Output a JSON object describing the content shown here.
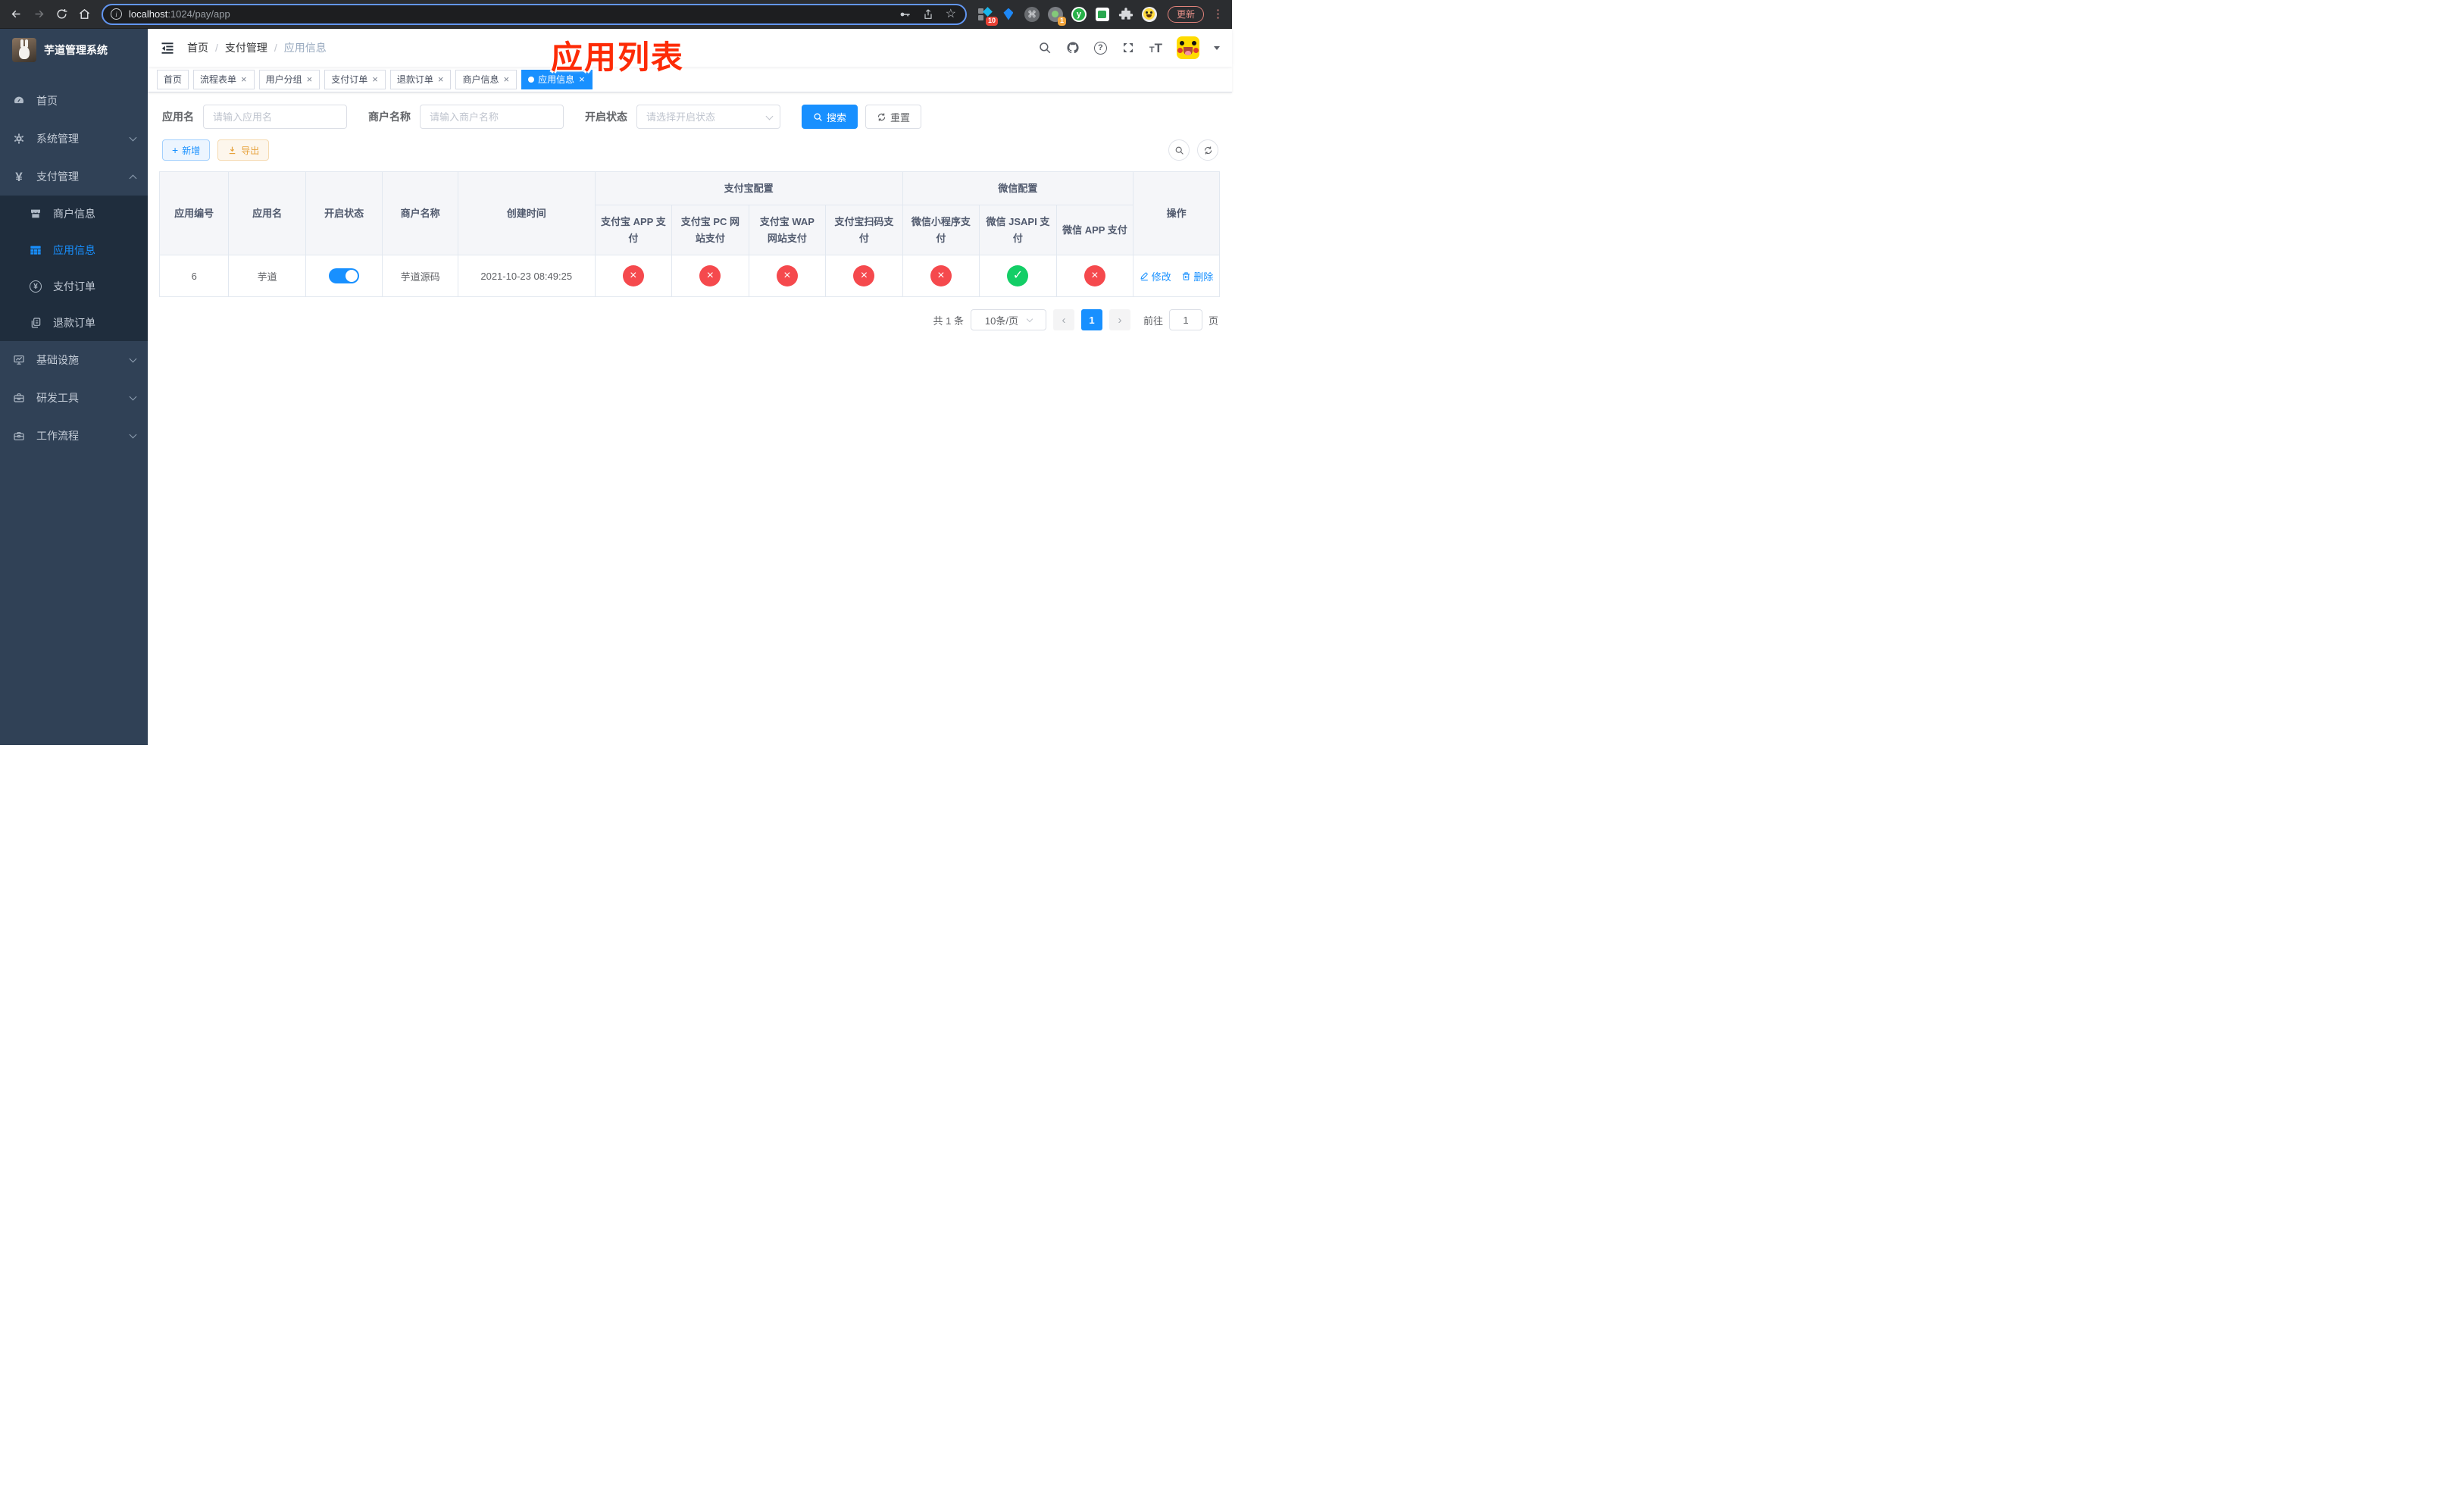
{
  "browser": {
    "url": {
      "host": "localhost",
      "path": ":1024/pay/app"
    },
    "update_button": "更新",
    "ext_badge_red": "10",
    "ext_badge_orange": "1",
    "cmd_glyph": "⌘",
    "y_glyph": "y"
  },
  "sidebar": {
    "logo_title": "芋道管理系统",
    "items": [
      {
        "label": "首页"
      },
      {
        "label": "系统管理"
      },
      {
        "label": "支付管理"
      },
      {
        "label": "商户信息"
      },
      {
        "label": "应用信息"
      },
      {
        "label": "支付订单"
      },
      {
        "label": "退款订单"
      },
      {
        "label": "基础设施"
      },
      {
        "label": "研发工具"
      },
      {
        "label": "工作流程"
      }
    ],
    "yen_glyph": "¥"
  },
  "navbar": {
    "breadcrumb": [
      "首页",
      "支付管理",
      "应用信息"
    ],
    "separator": "/"
  },
  "annotation": "应用列表",
  "tabs": [
    {
      "label": "首页",
      "closable": false,
      "active": false
    },
    {
      "label": "流程表单",
      "closable": true,
      "active": false
    },
    {
      "label": "用户分组",
      "closable": true,
      "active": false
    },
    {
      "label": "支付订单",
      "closable": true,
      "active": false
    },
    {
      "label": "退款订单",
      "closable": true,
      "active": false
    },
    {
      "label": "商户信息",
      "closable": true,
      "active": false
    },
    {
      "label": "应用信息",
      "closable": true,
      "active": true
    }
  ],
  "filters": {
    "app_name": {
      "label": "应用名",
      "placeholder": "请输入应用名",
      "value": ""
    },
    "merchant_name": {
      "label": "商户名称",
      "placeholder": "请输入商户名称",
      "value": ""
    },
    "status": {
      "label": "开启状态",
      "placeholder": "请选择开启状态",
      "value": ""
    },
    "search_label": "搜索",
    "reset_label": "重置"
  },
  "toolbar": {
    "add_label": "新增",
    "export_label": "导出"
  },
  "table": {
    "columns": [
      "应用编号",
      "应用名",
      "开启状态",
      "商户名称",
      "创建时间"
    ],
    "group_headers": [
      {
        "label": "支付宝配置",
        "colspan": 4
      },
      {
        "label": "微信配置",
        "colspan": 3
      }
    ],
    "sub_columns": [
      "支付宝 APP 支付",
      "支付宝 PC 网站支付",
      "支付宝 WAP 网站支付",
      "支付宝扫码支付",
      "微信小程序支付",
      "微信 JSAPI 支付",
      "微信 APP 支付"
    ],
    "action_header": "操作",
    "rows": [
      {
        "id": "6",
        "name": "芋道",
        "enabled": true,
        "merchant": "芋道源码",
        "created": "2021-10-23 08:49:25",
        "configs": [
          false,
          false,
          false,
          false,
          false,
          true,
          false
        ],
        "actions": [
          "修改",
          "删除"
        ]
      }
    ]
  },
  "pagination": {
    "total": "共 1 条",
    "page_size": "10条/页",
    "prev_glyph": "‹",
    "next_glyph": "›",
    "current_page": "1",
    "goto_label": "前往",
    "goto_value": "1",
    "page_suffix": "页"
  },
  "icons": {
    "check": "✓",
    "cross": "×",
    "close": "×",
    "star": "☆"
  },
  "colors": {
    "accent": "#1890ff",
    "success": "#13ce66",
    "danger": "#f5494d",
    "warning": "#e6a23c",
    "sidebar_bg": "#304156",
    "submenu_bg": "#1f2d3d",
    "annotation_red": "#fd2b06"
  }
}
